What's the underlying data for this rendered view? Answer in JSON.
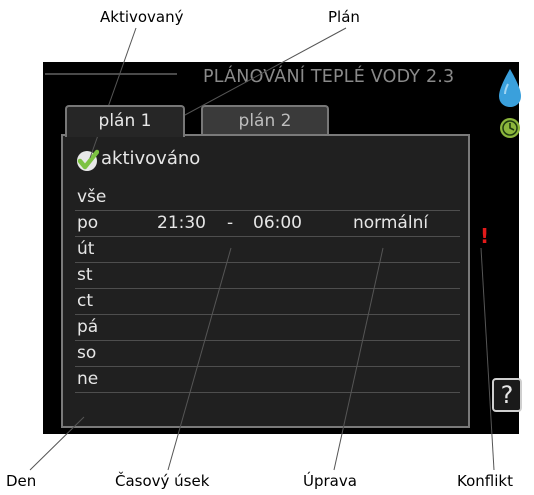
{
  "callouts": {
    "aktivovany": "Aktivovaný",
    "plan": "Plán",
    "den": "Den",
    "casovy_usek": "Časový úsek",
    "uprava": "Úprava",
    "konflikt": "Konflikt"
  },
  "screen": {
    "title": "PLÁNOVÁNÍ TEPLÉ VODY 2.3",
    "tabs": [
      {
        "label": "plán 1",
        "active": true
      },
      {
        "label": "plán 2",
        "active": false
      }
    ],
    "activated_label": "aktivováno",
    "conflict_mark": "!",
    "help_label": "?",
    "rows": [
      {
        "day": "vše",
        "start": "",
        "dash": "",
        "end": "",
        "mode": ""
      },
      {
        "day": "po",
        "start": "21:30",
        "dash": "-",
        "end": "06:00",
        "mode": "normální"
      },
      {
        "day": "út",
        "start": "",
        "dash": "",
        "end": "",
        "mode": ""
      },
      {
        "day": "st",
        "start": "",
        "dash": "",
        "end": "",
        "mode": ""
      },
      {
        "day": "ct",
        "start": "",
        "dash": "",
        "end": "",
        "mode": ""
      },
      {
        "day": "pá",
        "start": "",
        "dash": "",
        "end": "",
        "mode": ""
      },
      {
        "day": "so",
        "start": "",
        "dash": "",
        "end": "",
        "mode": ""
      },
      {
        "day": "ne",
        "start": "",
        "dash": "",
        "end": "",
        "mode": ""
      }
    ]
  },
  "colors": {
    "check": "#7cc242",
    "drop": "#3aa0dc",
    "clock": "#8cb63c",
    "conflict": "#e21a1a"
  },
  "icons": [
    "checkmark-icon",
    "water-drop-icon",
    "clock-icon",
    "help-icon"
  ]
}
